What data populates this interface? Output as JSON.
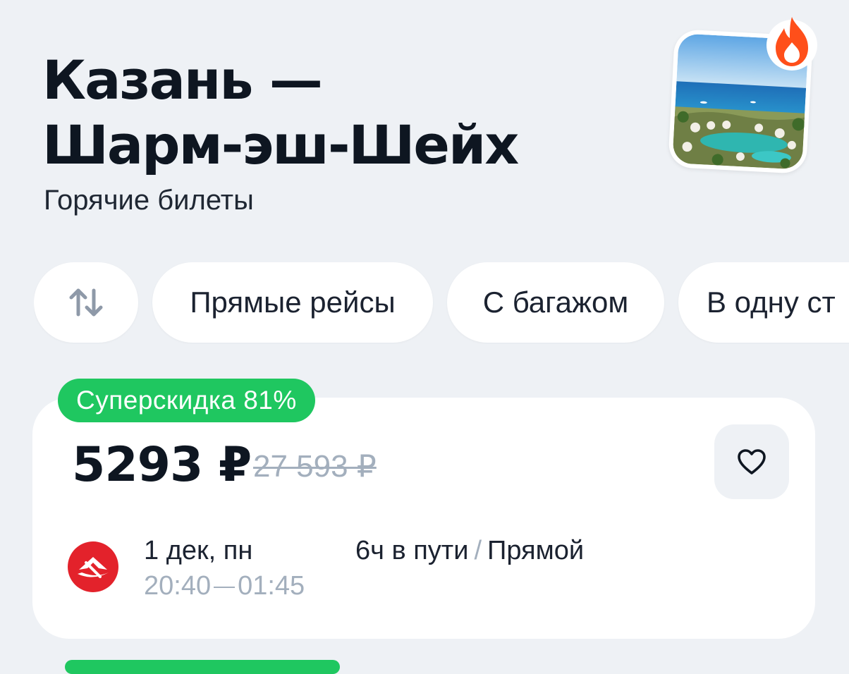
{
  "header": {
    "title_line1": "Казань —",
    "title_line2": "Шарм-эш-Шейх",
    "subtitle": "Горячие билеты"
  },
  "filters": {
    "sort_icon": "sort-arrows-icon",
    "items": [
      {
        "label": "Прямые рейсы"
      },
      {
        "label": "С багажом"
      },
      {
        "label": "В одну ст"
      }
    ]
  },
  "ticket": {
    "discount_label": "Суперскидка 81%",
    "price": "5293 ₽",
    "old_price": "27 593 ₽",
    "favorite_icon": "heart-icon",
    "date": "1 дек, пн",
    "depart_time": "20:40",
    "arrive_time": "01:45",
    "duration": "6ч в пути",
    "separator": "/",
    "stops": "Прямой"
  },
  "colors": {
    "background": "#eef1f5",
    "accent_green": "#1fc760",
    "text_primary": "#0e1621",
    "text_muted": "#a3afbd",
    "fire": "#ff4f1a",
    "airline_red": "#e3222b"
  }
}
